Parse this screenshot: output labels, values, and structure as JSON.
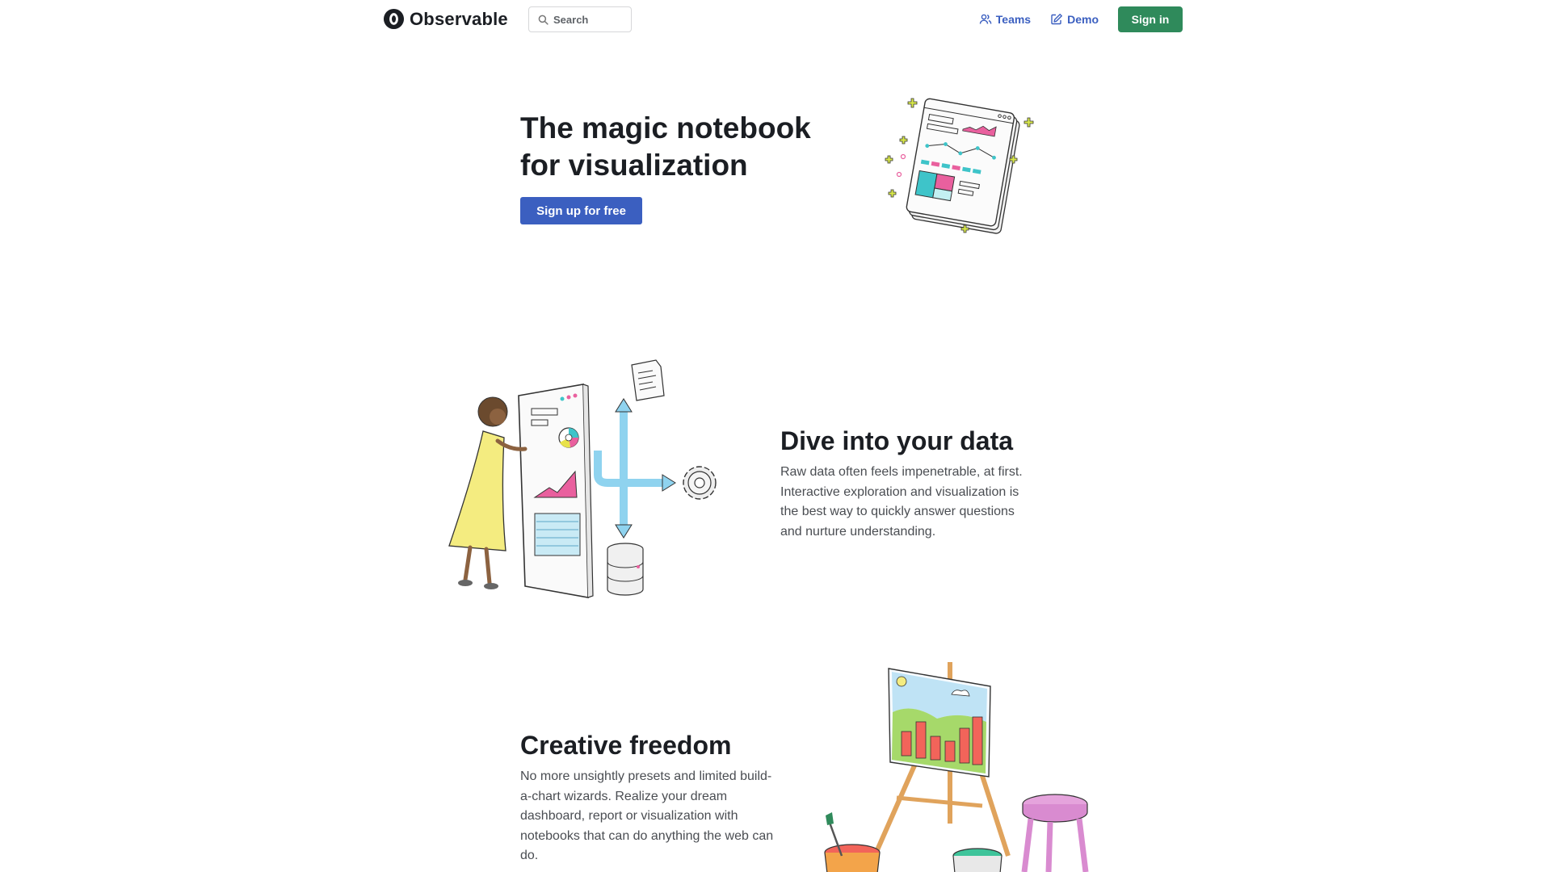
{
  "header": {
    "brand_name": "Observable",
    "search_placeholder": "Search",
    "nav": [
      {
        "label": "Teams",
        "icon": "users-icon"
      },
      {
        "label": "Demo",
        "icon": "edit-icon"
      }
    ],
    "signin_label": "Sign in"
  },
  "hero": {
    "title_line1": "The magic notebook",
    "title_line2": "for visualization",
    "cta_label": "Sign up for free"
  },
  "sections": [
    {
      "title": "Dive into your data",
      "text": "Raw data often feels impenetrable, at first. Interactive exploration and visualization is the best way to quickly answer questions and nurture understanding."
    },
    {
      "title": "Creative freedom",
      "text": "No more unsightly presets and limited build-a-chart wizards. Realize your dream dashboard, report or visualization with notebooks that can do anything the web can do."
    }
  ],
  "colors": {
    "primary": "#3b5fc0",
    "signin": "#2f8a5b",
    "text": "#1b1e23",
    "body_text": "#4a4d52"
  }
}
